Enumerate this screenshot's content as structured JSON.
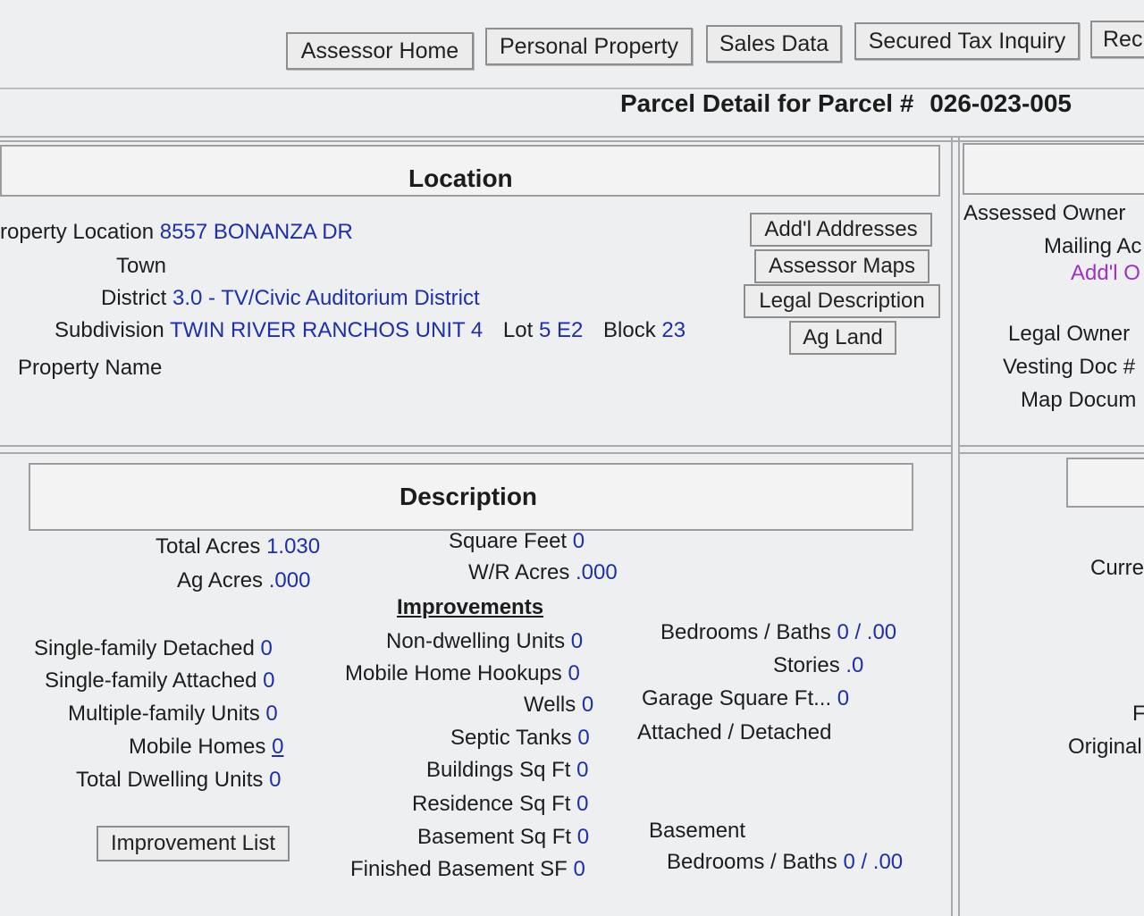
{
  "nav": {
    "assessor_home": "Assessor Home",
    "personal_property": "Personal Property",
    "sales_data": "Sales Data",
    "secured_tax_inquiry": "Secured Tax Inquiry",
    "recorder_partial": "Rec"
  },
  "header": {
    "title_label": "Parcel Detail for Parcel #",
    "parcel_number": "026-023-005"
  },
  "location": {
    "title": "Location",
    "property_location_label": "roperty Location",
    "property_location_value": "8557 BONANZA DR",
    "town_label": "Town",
    "district_label": "District",
    "district_value": "3.0 - TV/Civic Auditorium District",
    "subdivision_label": "Subdivision",
    "subdivision_value": "TWIN RIVER RANCHOS UNIT 4",
    "lot_label": "Lot",
    "lot_value": "5 E2",
    "block_label": "Block",
    "block_value": "23",
    "property_name_label": "Property Name",
    "buttons": {
      "addl_addresses": "Add'l Addresses",
      "assessor_maps": "Assessor Maps",
      "legal_description": "Legal Description",
      "ag_land": "Ag Land"
    }
  },
  "owner": {
    "assessed_owner_label": "Assessed Owner",
    "mailing_label": "Mailing Ac",
    "addl_link": "Add'l O",
    "legal_owner_label": "Legal Owner",
    "vesting_doc_label": "Vesting Doc #",
    "map_doc_label": "Map Docum"
  },
  "description": {
    "title": "Description",
    "total_acres_label": "Total Acres",
    "total_acres_value": "1.030",
    "ag_acres_label": "Ag Acres",
    "ag_acres_value": ".000",
    "square_feet_label": "Square Feet",
    "square_feet_value": "0",
    "wr_acres_label": "W/R Acres",
    "wr_acres_value": ".000",
    "improvements_heading": "Improvements",
    "sf_detached_label": "Single-family Detached",
    "sf_detached_value": "0",
    "sf_attached_label": "Single-family Attached",
    "sf_attached_value": "0",
    "multi_family_label": "Multiple-family Units",
    "multi_family_value": "0",
    "mobile_homes_label": "Mobile Homes",
    "mobile_homes_value": "0",
    "total_dwelling_label": "Total Dwelling Units",
    "total_dwelling_value": "0",
    "improvement_list_button": "Improvement List",
    "non_dwelling_label": "Non-dwelling Units",
    "non_dwelling_value": "0",
    "mobile_hookups_label": "Mobile Home Hookups",
    "mobile_hookups_value": "0",
    "wells_label": "Wells",
    "wells_value": "0",
    "septic_label": "Septic Tanks",
    "septic_value": "0",
    "buildings_sqft_label": "Buildings Sq Ft",
    "buildings_sqft_value": "0",
    "residence_sqft_label": "Residence Sq Ft",
    "residence_sqft_value": "0",
    "basement_sqft_label": "Basement Sq Ft",
    "basement_sqft_value": "0",
    "finished_basement_label": "Finished Basement SF",
    "finished_basement_value": "0",
    "bed_bath_label": "Bedrooms / Baths",
    "bed_bath_value": "0 / .00",
    "stories_label": "Stories",
    "stories_value": ".0",
    "garage_label": "Garage Square Ft...",
    "garage_value": "0",
    "attached_detached_label": "Attached / Detached",
    "basement_label": "Basement",
    "basement_bed_bath_label": "Bedrooms / Baths",
    "basement_bed_bath_value": "0 / .00"
  },
  "right_panel": {
    "curr_partial": "Curre",
    "f_partial": "F",
    "original_partial": "Original"
  }
}
